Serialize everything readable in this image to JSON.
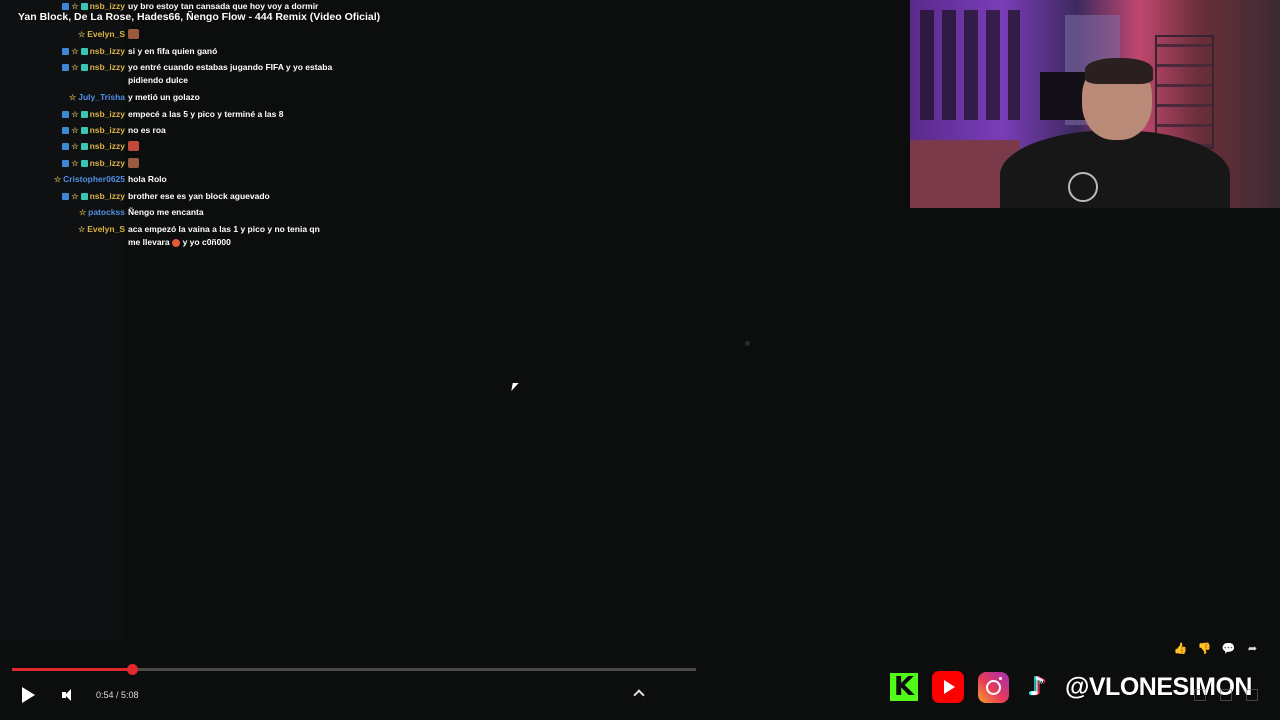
{
  "video": {
    "title": "Yan Block, De La Rose, Hades66, Ñengo Flow - 444 Remix (Video Oficial)",
    "current_time": "0:54",
    "duration": "5:08",
    "time_display": "0:54 / 5:08",
    "progress_fraction": 0.1753,
    "progress_color": "#e0282e"
  },
  "chat": [
    {
      "user": "nsb_izzy",
      "color": "#d9b342",
      "badges": [
        "blue",
        "star",
        "cyan"
      ],
      "text": "uy bro estoy tan cansada que hoy voy a dormir"
    },
    {
      "user": "Evelyn_S",
      "color": "#d9b342",
      "badges": [
        "star"
      ],
      "text": "",
      "emote": "brown"
    },
    {
      "user": "nsb_izzy",
      "color": "#d9b342",
      "badges": [
        "blue",
        "star",
        "cyan"
      ],
      "text": "si y en fifa quien ganó"
    },
    {
      "user": "nsb_izzy",
      "color": "#d9b342",
      "badges": [
        "blue",
        "star",
        "cyan"
      ],
      "text": "yo entré cuando estabas jugando FIFA y yo estaba pidiendo dulce"
    },
    {
      "user": "July_Trisha",
      "color": "#4f8fe6",
      "badges": [
        "star"
      ],
      "text": "y metió un golazo"
    },
    {
      "user": "nsb_izzy",
      "color": "#d9b342",
      "badges": [
        "blue",
        "star",
        "cyan"
      ],
      "text": "empecé a las 5 y pico y terminé a las 8"
    },
    {
      "user": "nsb_izzy",
      "color": "#d9b342",
      "badges": [
        "blue",
        "star",
        "cyan"
      ],
      "text": "no es roa"
    },
    {
      "user": "nsb_izzy",
      "color": "#d9b342",
      "badges": [
        "blue",
        "star",
        "cyan"
      ],
      "text": "",
      "emote": "red"
    },
    {
      "user": "nsb_izzy",
      "color": "#d9b342",
      "badges": [
        "blue",
        "star",
        "cyan"
      ],
      "text": "",
      "emote": "brown"
    },
    {
      "user": "Cristopher0625",
      "color": "#4f8fe6",
      "badges": [
        "star"
      ],
      "text": "hola Rolo"
    },
    {
      "user": "nsb_izzy",
      "color": "#d9b342",
      "badges": [
        "blue",
        "star",
        "cyan"
      ],
      "text": "brother ese es yan block aguevado"
    },
    {
      "user": "patockss",
      "color": "#4f8fe6",
      "badges": [
        "star"
      ],
      "text": "Ñengo me encanta"
    },
    {
      "user": "Evelyn_S",
      "color": "#d9b342",
      "badges": [
        "star"
      ],
      "text": "aca empezó la vaina a las 1 y pico y no tenia qn me llevara",
      "text2": "y yo c0ñ000",
      "emote": "face"
    }
  ],
  "side_actions": [
    {
      "name": "like-icon",
      "glyph": "👍"
    },
    {
      "name": "dislike-icon",
      "glyph": "👎"
    },
    {
      "name": "comment-icon",
      "glyph": "💬"
    },
    {
      "name": "share-icon",
      "glyph": "➦"
    }
  ],
  "controls": {
    "play_icon": "play-icon",
    "volume_icon": "volume-icon",
    "expand_icon": "chevron-up-icon"
  },
  "socials": {
    "kick_glyph": "K",
    "tiktok_glyph": "♪",
    "handle": "@VLONESIMON"
  }
}
